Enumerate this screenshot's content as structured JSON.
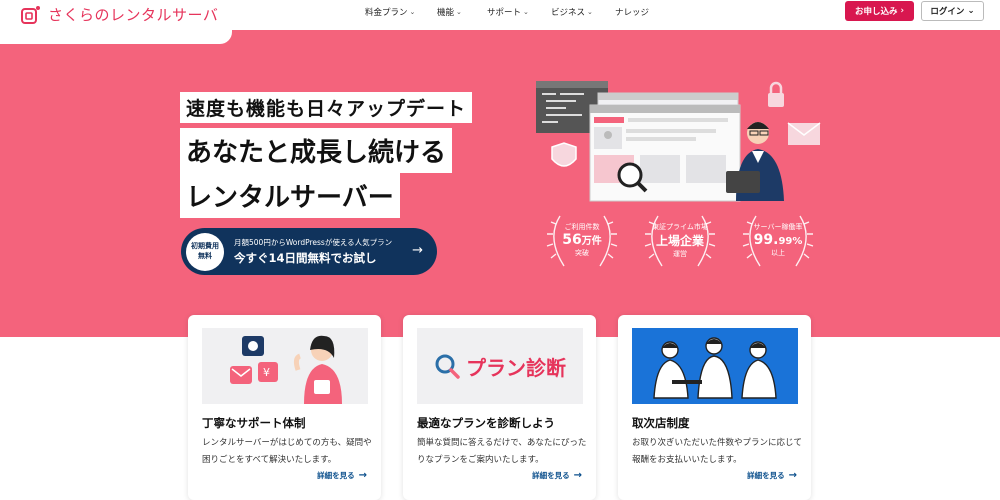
{
  "header": {
    "logo_text": "さくらのレンタルサーバ",
    "nav": [
      {
        "label": "料金プラン",
        "chevron": "⌄"
      },
      {
        "label": "機能",
        "chevron": "⌄"
      },
      {
        "label": "サポート",
        "chevron": "⌄"
      },
      {
        "label": "ビジネス",
        "chevron": "⌄"
      },
      {
        "label": "ナレッジ",
        "chevron": ""
      }
    ],
    "apply_label": "お申し込み",
    "apply_arrow": "›",
    "login_label": "ログイン",
    "login_chevron": "⌄"
  },
  "hero": {
    "tagline": "速度も機能も日々アップデート",
    "headline_line1": "あなたと成長し続ける",
    "headline_line2": "レンタルサーバー",
    "cta": {
      "badge_line1": "初期費用",
      "badge_line2": "無料",
      "sub": "月額500円からWordPressが使える人気プラン",
      "main": "今すぐ14日間無料でお試し",
      "arrow": "→"
    },
    "awards": [
      {
        "label": "ご利用件数",
        "value": "56",
        "unit": "万件",
        "caption": "突破"
      },
      {
        "label": "東証プライム市場",
        "value": "上場企業",
        "unit": "",
        "caption": "運営"
      },
      {
        "label": "サーバー稼働率",
        "value": "99.",
        "unit": "99%",
        "caption": "以上"
      }
    ]
  },
  "cards": [
    {
      "title": "丁寧なサポート体制",
      "text": "レンタルサーバーがはじめての方も、疑問や困りごとをすべて解決いたします。",
      "more": "詳細を見る",
      "arrow": "→"
    },
    {
      "title": "最適なプランを診断しよう",
      "text": "簡単な質問に答えるだけで、あなたにぴったりなプランをご案内いたします。",
      "more": "詳細を見る",
      "arrow": "→",
      "image_text": "プラン診断"
    },
    {
      "title": "取次店制度",
      "text": "お取り次ぎいただいた件数やプランに応じて報酬をお支払いいたします。",
      "more": "詳細を見る",
      "arrow": "→"
    }
  ],
  "colors": {
    "brand": "#e6345b",
    "hero_bg": "#f4637c",
    "cta_bg": "#10335c",
    "apply_bg": "#d8174f",
    "link": "#0b4f8c"
  }
}
